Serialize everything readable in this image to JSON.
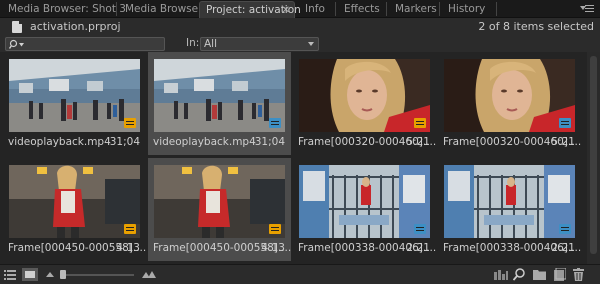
{
  "tabs": [
    {
      "label": "Media Browser: Shot 3"
    },
    {
      "label": "Media Browser"
    },
    {
      "label": "Project: activation",
      "active": true
    },
    {
      "label": "Info"
    },
    {
      "label": "Effects"
    },
    {
      "label": "Markers"
    },
    {
      "label": "History"
    }
  ],
  "header": {
    "project_name": "activation.prproj",
    "items_selected": "2 of 8 items selected"
  },
  "search": {
    "in_label": "In:",
    "in_value": "All"
  },
  "items": [
    {
      "name": "videoplayback.mp4",
      "duration": "31;04",
      "badge": "orange",
      "selected": false,
      "thumb": "hall"
    },
    {
      "name": "videoplayback.mp4",
      "duration": "31;04",
      "badge": "blue",
      "selected": true,
      "thumb": "hall"
    },
    {
      "name": "Frame[000320-000460]....",
      "duration": "5:21",
      "badge": "orange",
      "selected": false,
      "thumb": "face"
    },
    {
      "name": "Frame[000320-000460]....",
      "duration": "5:21",
      "badge": "blue",
      "selected": false,
      "thumb": "face"
    },
    {
      "name": "Frame[000450-000558]....",
      "duration": "4:13",
      "badge": "orange",
      "selected": false,
      "thumb": "room"
    },
    {
      "name": "Frame[000450-000558]....",
      "duration": "4:13",
      "badge": "orange",
      "selected": true,
      "thumb": "room"
    },
    {
      "name": "Frame[000338-000406]....",
      "duration": "2:21",
      "badge": "blue",
      "selected": false,
      "thumb": "street"
    },
    {
      "name": "Frame[000338-000406]....",
      "duration": "2:21",
      "badge": "blue",
      "selected": false,
      "thumb": "street"
    }
  ],
  "colors": {
    "accent_orange": "#e8a000",
    "accent_blue": "#3d8fc4",
    "selection": "#4c4c4c"
  },
  "toolbar_icons": [
    "list-view-icon",
    "icon-view-icon",
    "zoom-out-icon",
    "zoom-slider",
    "zoom-in-icon",
    "automate-to-sequence-icon",
    "find-icon",
    "new-bin-icon",
    "new-item-icon",
    "clear-icon"
  ]
}
